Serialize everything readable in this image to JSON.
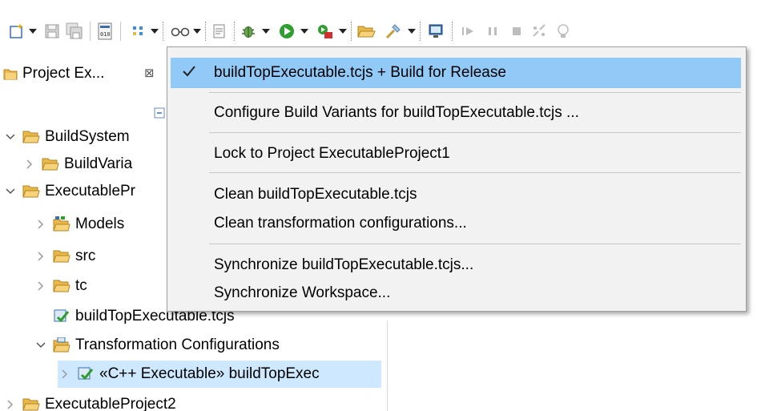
{
  "toolbar": {
    "icons": [
      "new-icon",
      "save-icon",
      "save-all-icon",
      "binary-icon",
      "build-variants-icon",
      "glasses-icon",
      "template-icon",
      "bug-icon",
      "run-icon",
      "external-tools-icon",
      "open-folder-icon",
      "wrench-icon",
      "display-icon",
      "resume-icon",
      "suspend-icon",
      "terminate-icon",
      "disconnect-icon",
      "lightbulb-icon"
    ]
  },
  "explorer": {
    "tab_title": "Project Ex...",
    "close_glyph": "⊠",
    "tree": [
      {
        "label": "BuildSystem",
        "expanded": true
      },
      {
        "label": "BuildVaria",
        "expanded": false
      },
      {
        "label": "ExecutablePr",
        "expanded": true
      },
      {
        "label": "Models",
        "expanded": false
      },
      {
        "label": "src",
        "expanded": false
      },
      {
        "label": "tc",
        "expanded": false
      },
      {
        "label": "buildTopExecutable.tcjs"
      },
      {
        "label": "Transformation Configurations",
        "expanded": true
      },
      {
        "label": "«C++ Executable» buildTopExec",
        "expanded": false,
        "selected": true
      },
      {
        "label": "ExecutableProject2",
        "expanded": false
      }
    ]
  },
  "menu": {
    "items": [
      {
        "label": "buildTopExecutable.tcjs + Build for Release",
        "checked": true,
        "highlighted": true
      },
      {
        "label": "Configure Build Variants for buildTopExecutable.tcjs ..."
      },
      {
        "label": "Lock to Project ExecutableProject1"
      },
      {
        "label": "Clean buildTopExecutable.tcjs"
      },
      {
        "label": "Clean transformation configurations..."
      },
      {
        "label": "Synchronize buildTopExecutable.tcjs..."
      },
      {
        "label": "Synchronize Workspace..."
      }
    ]
  },
  "colors": {
    "highlight": "#91c9f7",
    "selection": "#cde8ff",
    "folder": "#e8b84a",
    "menu_bg": "#f2f2f2"
  }
}
